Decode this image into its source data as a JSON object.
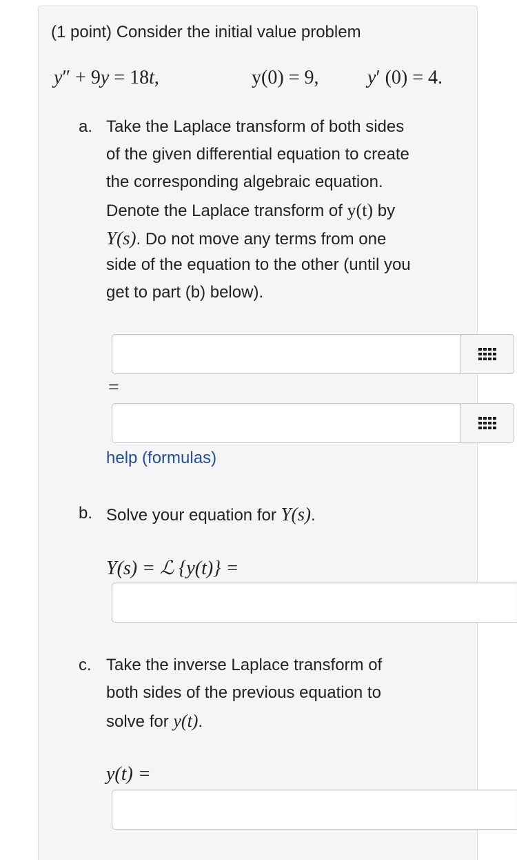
{
  "problem": {
    "header": "(1 point) Consider the initial value problem",
    "equation": {
      "lhs_y": "y",
      "lhs_prime": "″",
      "lhs_rest_plus": " + 9",
      "lhs_y2": "y",
      "lhs_eq": " = 18",
      "lhs_t": "t",
      "lhs_comma": ",",
      "ic1": "y(0) = 9,",
      "ic2_y": "y",
      "ic2_rest": "′ (0) = 4."
    }
  },
  "part_a": {
    "marker": "a.",
    "line1": "Take the Laplace transform of both sides",
    "line2": "of the given differential equation to create",
    "line3": "the corresponding algebraic equation.",
    "line4_pre": "Denote the Laplace transform of ",
    "line4_math": "y(t)",
    "line4_post": " by",
    "line5_math": "Y(s)",
    "line5_post": ". Do not move any terms from one",
    "line6": "side of the equation to the other (until you",
    "line7": "get to part (b) below).",
    "equals": "=",
    "input1_value": "",
    "input2_value": "",
    "help_link": "help (formulas)"
  },
  "part_b": {
    "marker": "b.",
    "text": "Solve your equation for ",
    "text_math": "Y(s)",
    "text_end": ".",
    "label": "Y(s) = ℒ {y(t)} =",
    "input_value": ""
  },
  "part_c": {
    "marker": "c.",
    "line1": "Take the inverse Laplace transform of",
    "line2": "both sides of the previous equation to",
    "line3_pre": "solve for ",
    "line3_math": "y(t)",
    "line3_post": ".",
    "label": "y(t) =",
    "input_value": ""
  },
  "icons": {
    "equation_editor": "grid-icon"
  }
}
